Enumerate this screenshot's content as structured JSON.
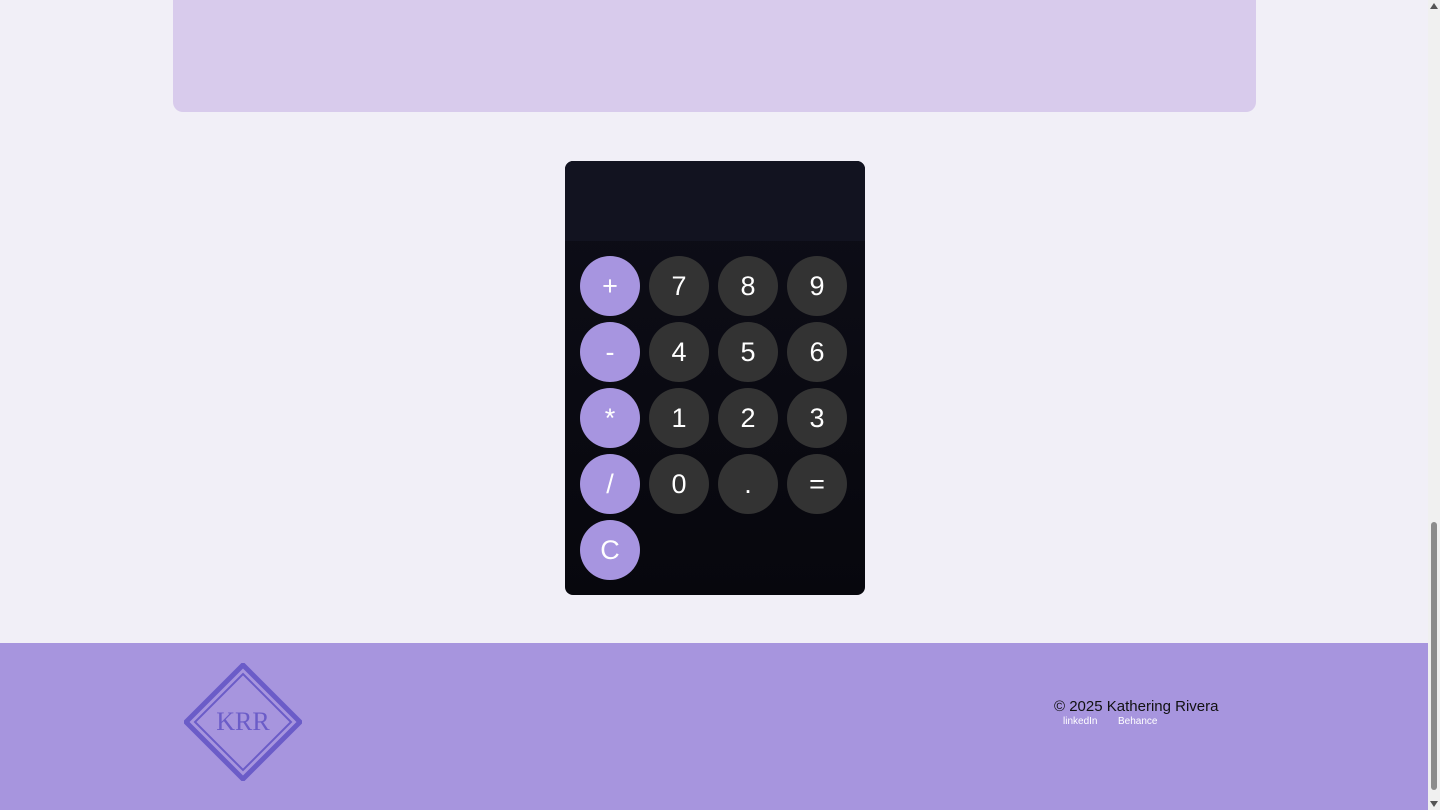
{
  "calculator": {
    "display_value": "",
    "keys": [
      {
        "label": "+",
        "type": "op",
        "name": "add-button"
      },
      {
        "label": "7",
        "type": "num",
        "name": "digit-7-button"
      },
      {
        "label": "8",
        "type": "num",
        "name": "digit-8-button"
      },
      {
        "label": "9",
        "type": "num",
        "name": "digit-9-button"
      },
      {
        "label": "-",
        "type": "op",
        "name": "subtract-button"
      },
      {
        "label": "4",
        "type": "num",
        "name": "digit-4-button"
      },
      {
        "label": "5",
        "type": "num",
        "name": "digit-5-button"
      },
      {
        "label": "6",
        "type": "num",
        "name": "digit-6-button"
      },
      {
        "label": "*",
        "type": "op",
        "name": "multiply-button"
      },
      {
        "label": "1",
        "type": "num",
        "name": "digit-1-button"
      },
      {
        "label": "2",
        "type": "num",
        "name": "digit-2-button"
      },
      {
        "label": "3",
        "type": "num",
        "name": "digit-3-button"
      },
      {
        "label": "/",
        "type": "op",
        "name": "divide-button"
      },
      {
        "label": "0",
        "type": "num",
        "name": "digit-0-button"
      },
      {
        "label": ".",
        "type": "num",
        "name": "decimal-button"
      },
      {
        "label": "=",
        "type": "num",
        "name": "equals-button"
      },
      {
        "label": "C",
        "type": "op",
        "name": "clear-button"
      }
    ]
  },
  "footer": {
    "logo_text": "KRR",
    "copyright": "© 2025 Kathering Rivera",
    "links": [
      "linkedIn",
      "Behance"
    ]
  },
  "colors": {
    "page_background": "#f1eff7",
    "top_panel": "#d8cbec",
    "operator_key": "#a795e0",
    "number_key": "#333333",
    "footer": "#a795de",
    "logo": "#6b5cc8"
  },
  "icons": {
    "scroll_up": "caret-up-icon",
    "scroll_down": "caret-down-icon"
  }
}
